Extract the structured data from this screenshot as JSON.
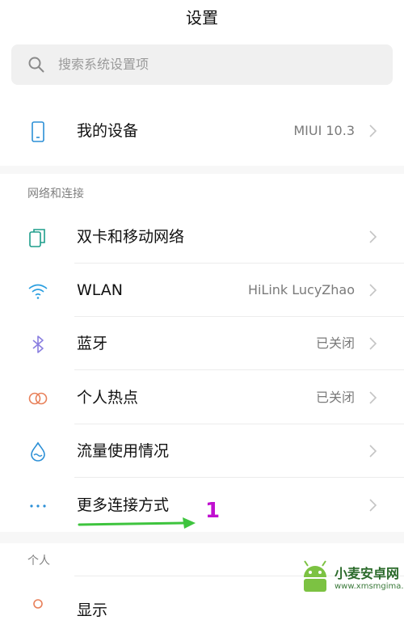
{
  "header": {
    "title": "设置"
  },
  "search": {
    "placeholder": "搜索系统设置项"
  },
  "device": {
    "label": "我的设备",
    "value": "MIUI 10.3"
  },
  "network": {
    "section_label": "网络和连接",
    "items": [
      {
        "label": "双卡和移动网络",
        "value": "",
        "icon": "sim-card-icon"
      },
      {
        "label": "WLAN",
        "value": "HiLink LucyZhao",
        "icon": "wifi-icon"
      },
      {
        "label": "蓝牙",
        "value": "已关闭",
        "icon": "bluetooth-icon"
      },
      {
        "label": "个人热点",
        "value": "已关闭",
        "icon": "hotspot-icon"
      },
      {
        "label": "流量使用情况",
        "value": "",
        "icon": "data-drop-icon"
      },
      {
        "label": "更多连接方式",
        "value": "",
        "icon": "more-dots-icon"
      }
    ]
  },
  "personal": {
    "section_label": "个人",
    "items": [
      {
        "label": "显示",
        "icon": "display-icon"
      }
    ]
  },
  "annotation": {
    "number": "1",
    "arrow_color": "#3ec43e",
    "number_color": "#c010d0"
  },
  "watermark": {
    "text": "小麦安卓网",
    "url": "www.xmsmgima.com"
  },
  "colors": {
    "accent": "#2b8fd6",
    "chevron": "#c4c4c4",
    "separator": "#f7f7f7"
  }
}
